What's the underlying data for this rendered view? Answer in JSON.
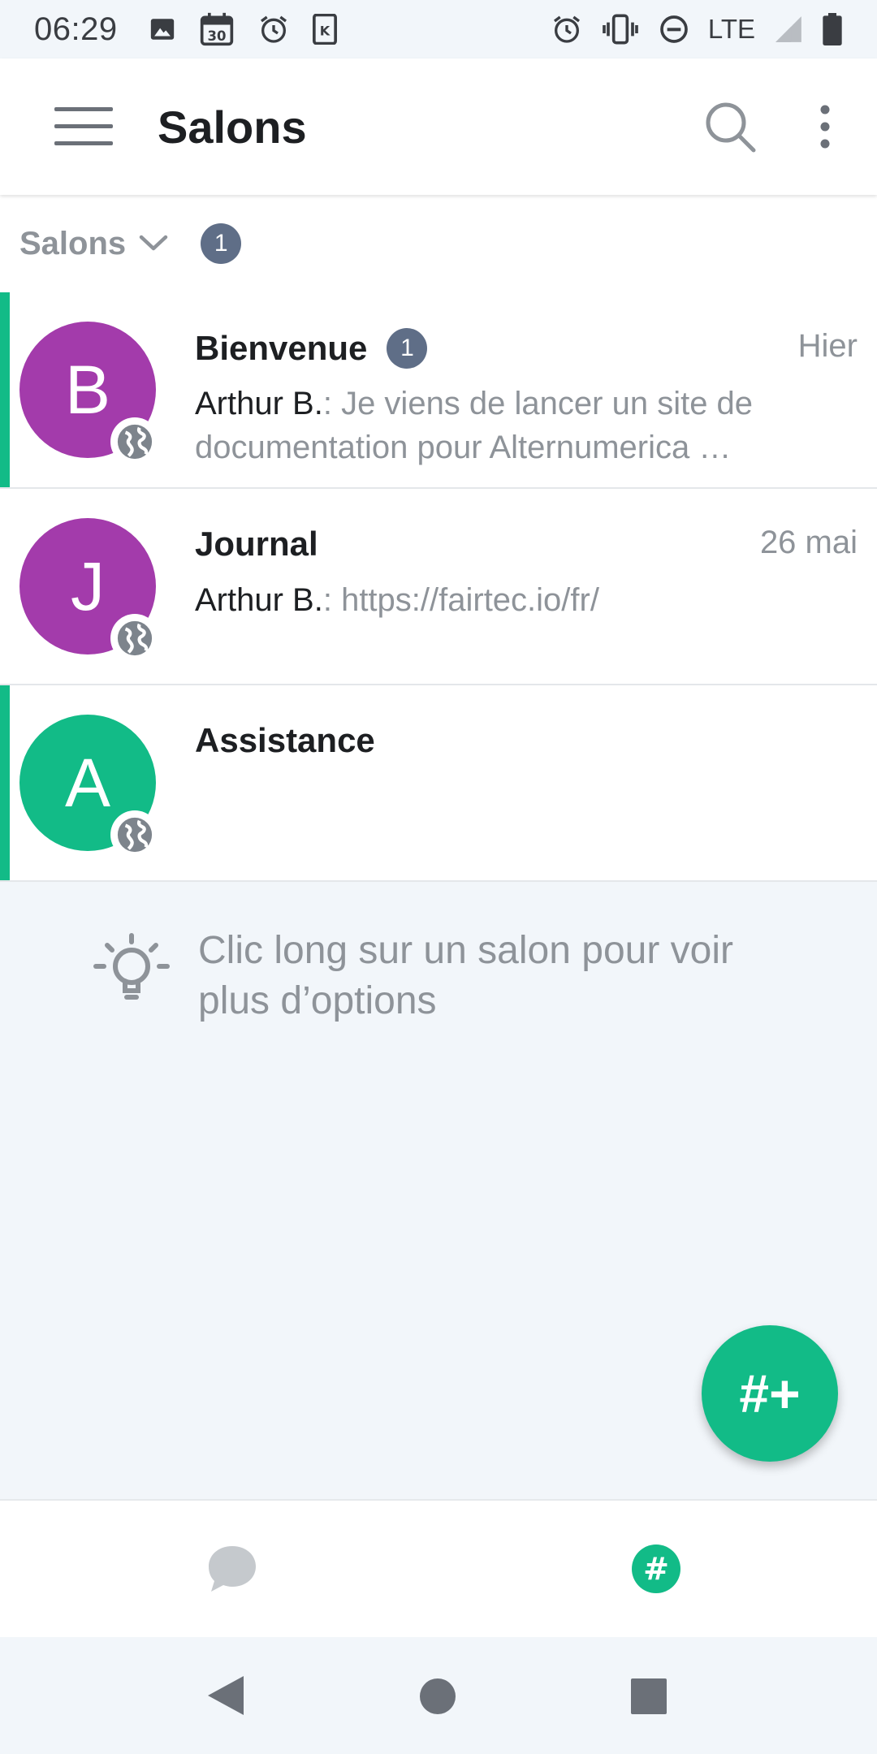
{
  "status_bar": {
    "time": "06:29",
    "left_icons": [
      "image-icon",
      "calendar-icon",
      "alarm-icon",
      "k-app-icon"
    ],
    "calendar_day": "30",
    "k_glyph": "K",
    "network": "LTE",
    "right_icons": [
      "alarm-icon",
      "vibrate-icon",
      "dnd-icon",
      "signal-icon",
      "battery-icon"
    ]
  },
  "app_bar": {
    "title": "Salons",
    "icons": [
      "menu-icon",
      "search-icon",
      "more-vert-icon"
    ]
  },
  "section": {
    "label": "Salons",
    "count": "1"
  },
  "rooms": [
    {
      "initial": "B",
      "name": "Bienvenue",
      "badge": "1",
      "time": "Hier",
      "author": "Arthur B.",
      "message": ": Je viens de lancer un site de documentation pour Alternumerica …",
      "avatar_color": "#a33bab",
      "unread": true
    },
    {
      "initial": "J",
      "name": "Journal",
      "time": "26 mai",
      "author": "Arthur B.",
      "message": ": https://fairtec.io/fr/",
      "avatar_color": "#a33bab",
      "unread": false
    },
    {
      "initial": "A",
      "name": "Assistance",
      "avatar_color": "#12bb87",
      "unread": true
    }
  ],
  "hint": {
    "text": "Clic long sur un salon pour voir plus d’options",
    "icon": "lightbulb-icon"
  },
  "fab": {
    "label": "#+"
  },
  "bottom_nav": {
    "items": [
      "chat-bubble-icon",
      "hash-icon"
    ],
    "hash_glyph": "#",
    "active_color": "#12bb87",
    "inactive_color": "#c5c9cd"
  },
  "accent_color": "#12bb87"
}
